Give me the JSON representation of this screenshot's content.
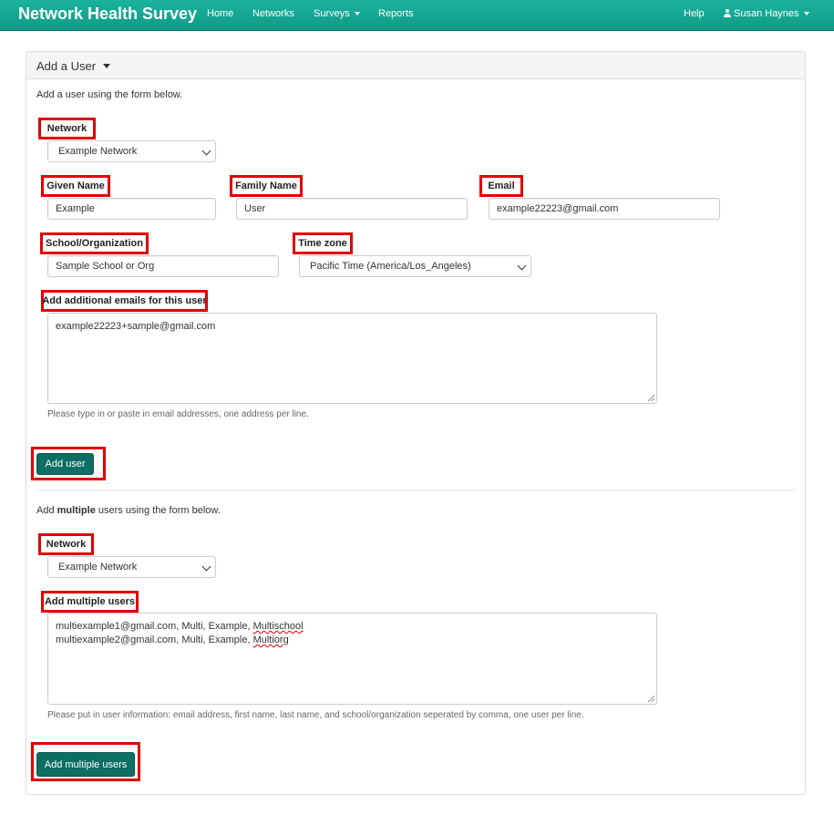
{
  "navbar": {
    "brand": "Network Health Survey",
    "links": [
      "Home",
      "Networks",
      "Surveys",
      "Reports"
    ],
    "help": "Help",
    "user": "Susan Haynes"
  },
  "panel": {
    "title": "Add a User",
    "intro": "Add a user using the form below.",
    "single": {
      "network_label": "Network",
      "network_value": "Example Network",
      "given_label": "Given Name",
      "given_value": "Example",
      "family_label": "Family Name",
      "family_value": "User",
      "email_label": "Email",
      "email_value": "example22223@gmail.com",
      "school_label": "School/Organization",
      "school_value": "Sample School or Org",
      "timezone_label": "Time zone",
      "timezone_value": "Pacific Time (America/Los_Angeles)",
      "additional_label": "Add additional emails for this user",
      "additional_value": "example22223+sample@gmail.com",
      "additional_help": "Please type in or paste in email addresses, one address per line.",
      "submit_label": "Add user"
    },
    "multiple": {
      "intro_prefix": "Add ",
      "intro_bold": "multiple",
      "intro_suffix": " users using the form below.",
      "network_label": "Network",
      "network_value": "Example Network",
      "users_label": "Add multiple users",
      "line1_prefix": "multiexample1@gmail.com, Multi, Example, ",
      "line1_word": "Multischool",
      "line2_prefix": "multiexample2@gmail.com, Multi, Example, ",
      "line2_word": "Multiorg",
      "help": "Please put in user information: email address, first name, last name, and school/organization seperated by comma, one user per line.",
      "submit_label": "Add multiple users"
    }
  },
  "colors": {
    "navbar": "#15a892",
    "button": "#0d6e63",
    "highlight": "#e00000"
  }
}
